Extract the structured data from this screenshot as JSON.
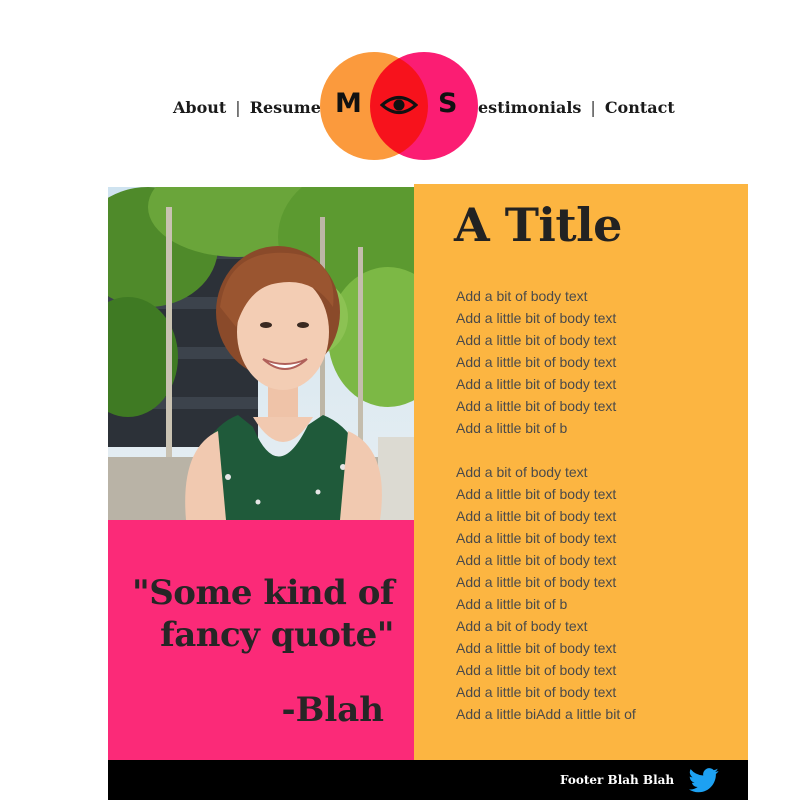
{
  "nav": {
    "left": [
      "About",
      "Resume"
    ],
    "right": [
      "estimonials",
      "Contact"
    ],
    "separator": "|"
  },
  "logo": {
    "letter_left": "M",
    "letter_right": "S",
    "icon": "eye-icon",
    "color_left": "#fb9a3d",
    "color_right": "#fb1d73"
  },
  "quote": {
    "line1": "\"Some kind of",
    "line2": "fancy quote\"",
    "attribution": "-Blah"
  },
  "content": {
    "title": "A Title",
    "paragraph1": [
      "Add a bit of body text",
      "Add a little bit of body text",
      "Add a little bit of body text",
      "Add a little bit of body text",
      "Add a little bit of body text",
      "Add a little bit of body text",
      "Add a little bit of b"
    ],
    "paragraph2": [
      "Add a bit of body text",
      "Add a little bit of body text",
      "Add a little bit of body text",
      "Add a little bit of body text",
      "Add a little bit of body text",
      "Add a little bit of body text",
      "Add a little bit of b",
      "Add a bit of body text",
      "Add a little bit of body text",
      "Add a little bit of body text",
      "Add a little bit of body text",
      "Add a little biAdd a little bit of"
    ]
  },
  "footer": {
    "text": "Footer Blah Blah",
    "icon": "twitter-icon"
  },
  "colors": {
    "pink": "#fb2a78",
    "orange": "#fcb541",
    "footer": "#000000"
  }
}
